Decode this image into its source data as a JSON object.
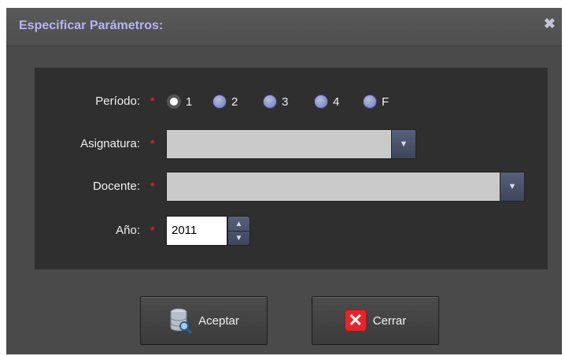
{
  "dialog": {
    "title": "Especificar Parámetros:",
    "close_glyph": "✖"
  },
  "form": {
    "periodo_label": "Período:",
    "periodo_options": [
      "1",
      "2",
      "3",
      "4",
      "F"
    ],
    "periodo_selected": "1",
    "asignatura_label": "Asignatura:",
    "asignatura_value": "",
    "docente_label": "Docente:",
    "docente_value": "",
    "anio_label": "Año:",
    "anio_value": "2011",
    "required_marker": "*"
  },
  "buttons": {
    "accept_label": "Aceptar",
    "close_label": "Cerrar"
  },
  "icons": {
    "close": "close-icon",
    "dropdown": "chevron-down-icon",
    "spinner_up": "chevron-up-icon",
    "spinner_down": "chevron-down-icon",
    "accept": "database-search-icon",
    "cancel": "red-x-icon"
  },
  "colors": {
    "title": "#b6b4f4",
    "required": "#e02020",
    "dialog_bg": "#4a4a4a",
    "panel_bg": "#2f2f2f"
  }
}
